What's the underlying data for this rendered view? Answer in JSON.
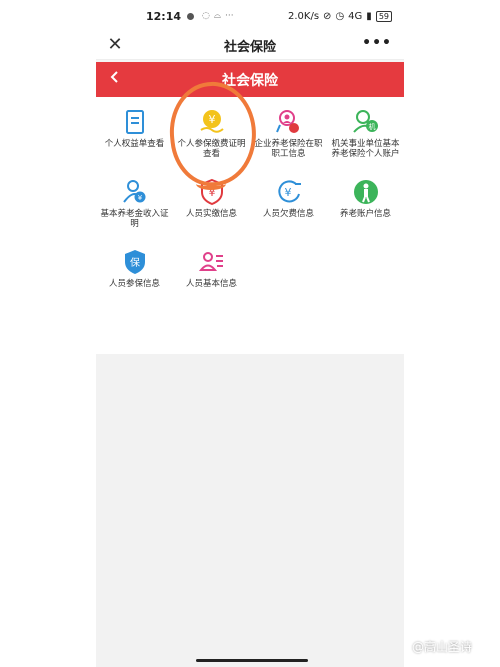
{
  "status_bar": {
    "time": "12:14",
    "speed": "2.0K/s",
    "network": "4G",
    "battery": "59"
  },
  "wechat_bar": {
    "close_icon": "close-icon",
    "title": "社会保险",
    "more_label": "•••"
  },
  "app_header": {
    "back_icon": "chevron-left-icon",
    "title": "社会保险"
  },
  "colors": {
    "header_red": "#e53a3f",
    "icon_blue": "#2e8fd8",
    "icon_green": "#3cb45a",
    "icon_red": "#e03a3f",
    "icon_yellow": "#f3c31b",
    "icon_pink": "#e0408a",
    "annotation_orange": "#f07a3a"
  },
  "tiles": [
    {
      "label": "个人权益单查看",
      "icon": "document-icon"
    },
    {
      "label": "个人参保缴费证明查看",
      "icon": "yuan-hand-icon"
    },
    {
      "label": "企业养老保险在职职工信息",
      "icon": "person-search-icon"
    },
    {
      "label": "机关事业单位基本养老保险个人账户",
      "icon": "person-badge-icon"
    },
    {
      "label": "基本养老金收入证明",
      "icon": "pension-proof-icon"
    },
    {
      "label": "人员实缴信息",
      "icon": "shield-yuan-icon"
    },
    {
      "label": "人员欠费信息",
      "icon": "yuan-arrears-icon"
    },
    {
      "label": "养老账户信息",
      "icon": "elderly-icon"
    },
    {
      "label": "人员参保信息",
      "icon": "insurance-badge-icon"
    },
    {
      "label": "人员基本信息",
      "icon": "profile-card-icon"
    }
  ],
  "watermark": "@高山圣诗"
}
